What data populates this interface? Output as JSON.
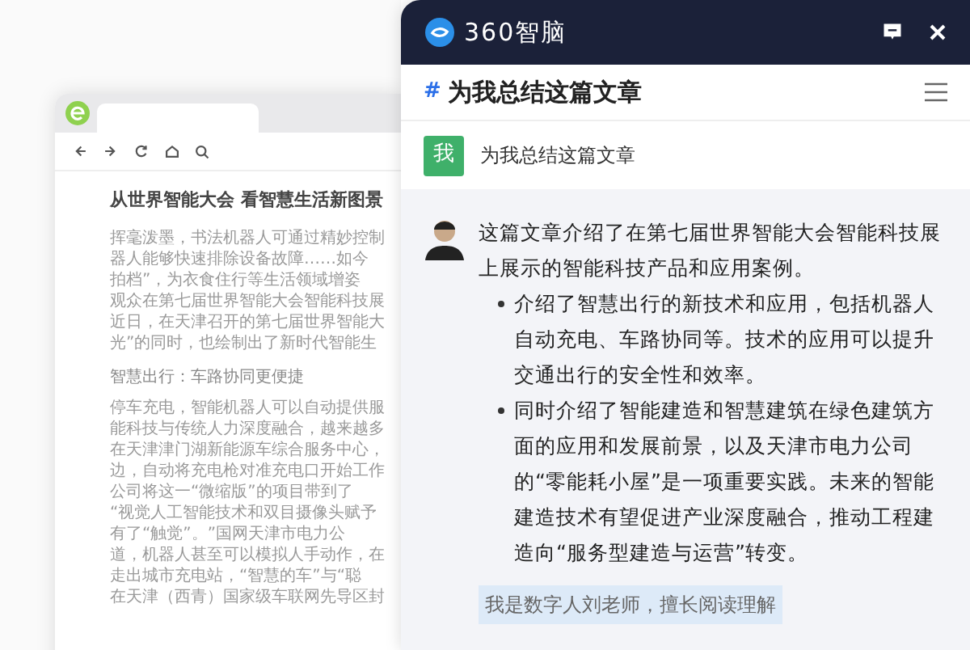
{
  "browser": {
    "article": {
      "title": "从世界智能大会 看智慧生活新图景",
      "lines": [
        {
          "kind": "text",
          "text": "挥毫泼墨，书法机器人可通过精妙控制"
        },
        {
          "kind": "text",
          "text": "器人能够快速排除设备故障……如今"
        },
        {
          "kind": "text",
          "text": "拍档”，为衣食住行等生活领域增姿"
        },
        {
          "kind": "text",
          "text": "观众在第七届世界智能大会智能科技展"
        },
        {
          "kind": "text",
          "text": "近日，在天津召开的第七届世界智能大"
        },
        {
          "kind": "text",
          "text": "光”的同时，也绘制出了新时代智能生"
        },
        {
          "kind": "heading",
          "text": "智慧出行：车路协同更便捷"
        },
        {
          "kind": "text",
          "text": "停车充电，智能机器人可以自动提供服"
        },
        {
          "kind": "text",
          "text": "能科技与传统人力深度融合，越来越多"
        },
        {
          "kind": "text",
          "text": "在天津津门湖新能源车综合服务中心，"
        },
        {
          "kind": "text",
          "text": "边，自动将充电枪对准充电口开始工作"
        },
        {
          "kind": "text",
          "text": "公司将这一“微缩版”的项目带到了"
        },
        {
          "kind": "text",
          "text": "“视觉人工智能技术和双目摄像头赋予"
        },
        {
          "kind": "text",
          "text": "有了“触觉”。”国网天津市电力公"
        },
        {
          "kind": "text",
          "text": "道，机器人甚至可以模拟人手动作，在"
        },
        {
          "kind": "text",
          "text": "走出城市充电站，“智慧的车”与“聪"
        },
        {
          "kind": "text",
          "text": "在天津（西青）国家级车联网先导区封"
        }
      ]
    }
  },
  "assistant": {
    "brand": "360智脑",
    "topic": {
      "mark": "#",
      "title": "为我总结这篇文章"
    },
    "user_message": {
      "avatar": "我",
      "text": "为我总结这篇文章"
    },
    "reply": {
      "intro": "这篇文章介绍了在第七届世界智能大会智能科技展上展示的智能科技产品和应用案例。",
      "bullets": [
        "介绍了智慧出行的新技术和应用，包括机器人自动充电、车路协同等。技术的应用可以提升交通出行的安全性和效率。",
        "同时介绍了智能建造和智慧建筑在绿色建筑方面的应用和发展前景，以及天津市电力公司的“零能耗小屋”是一项重要实践。未来的智能建造技术有望促进产业深度融合，推动工程建造向“服务型建造与运营”转变。"
      ]
    },
    "hint": "我是数字人刘老师，擅长阅读理解"
  }
}
